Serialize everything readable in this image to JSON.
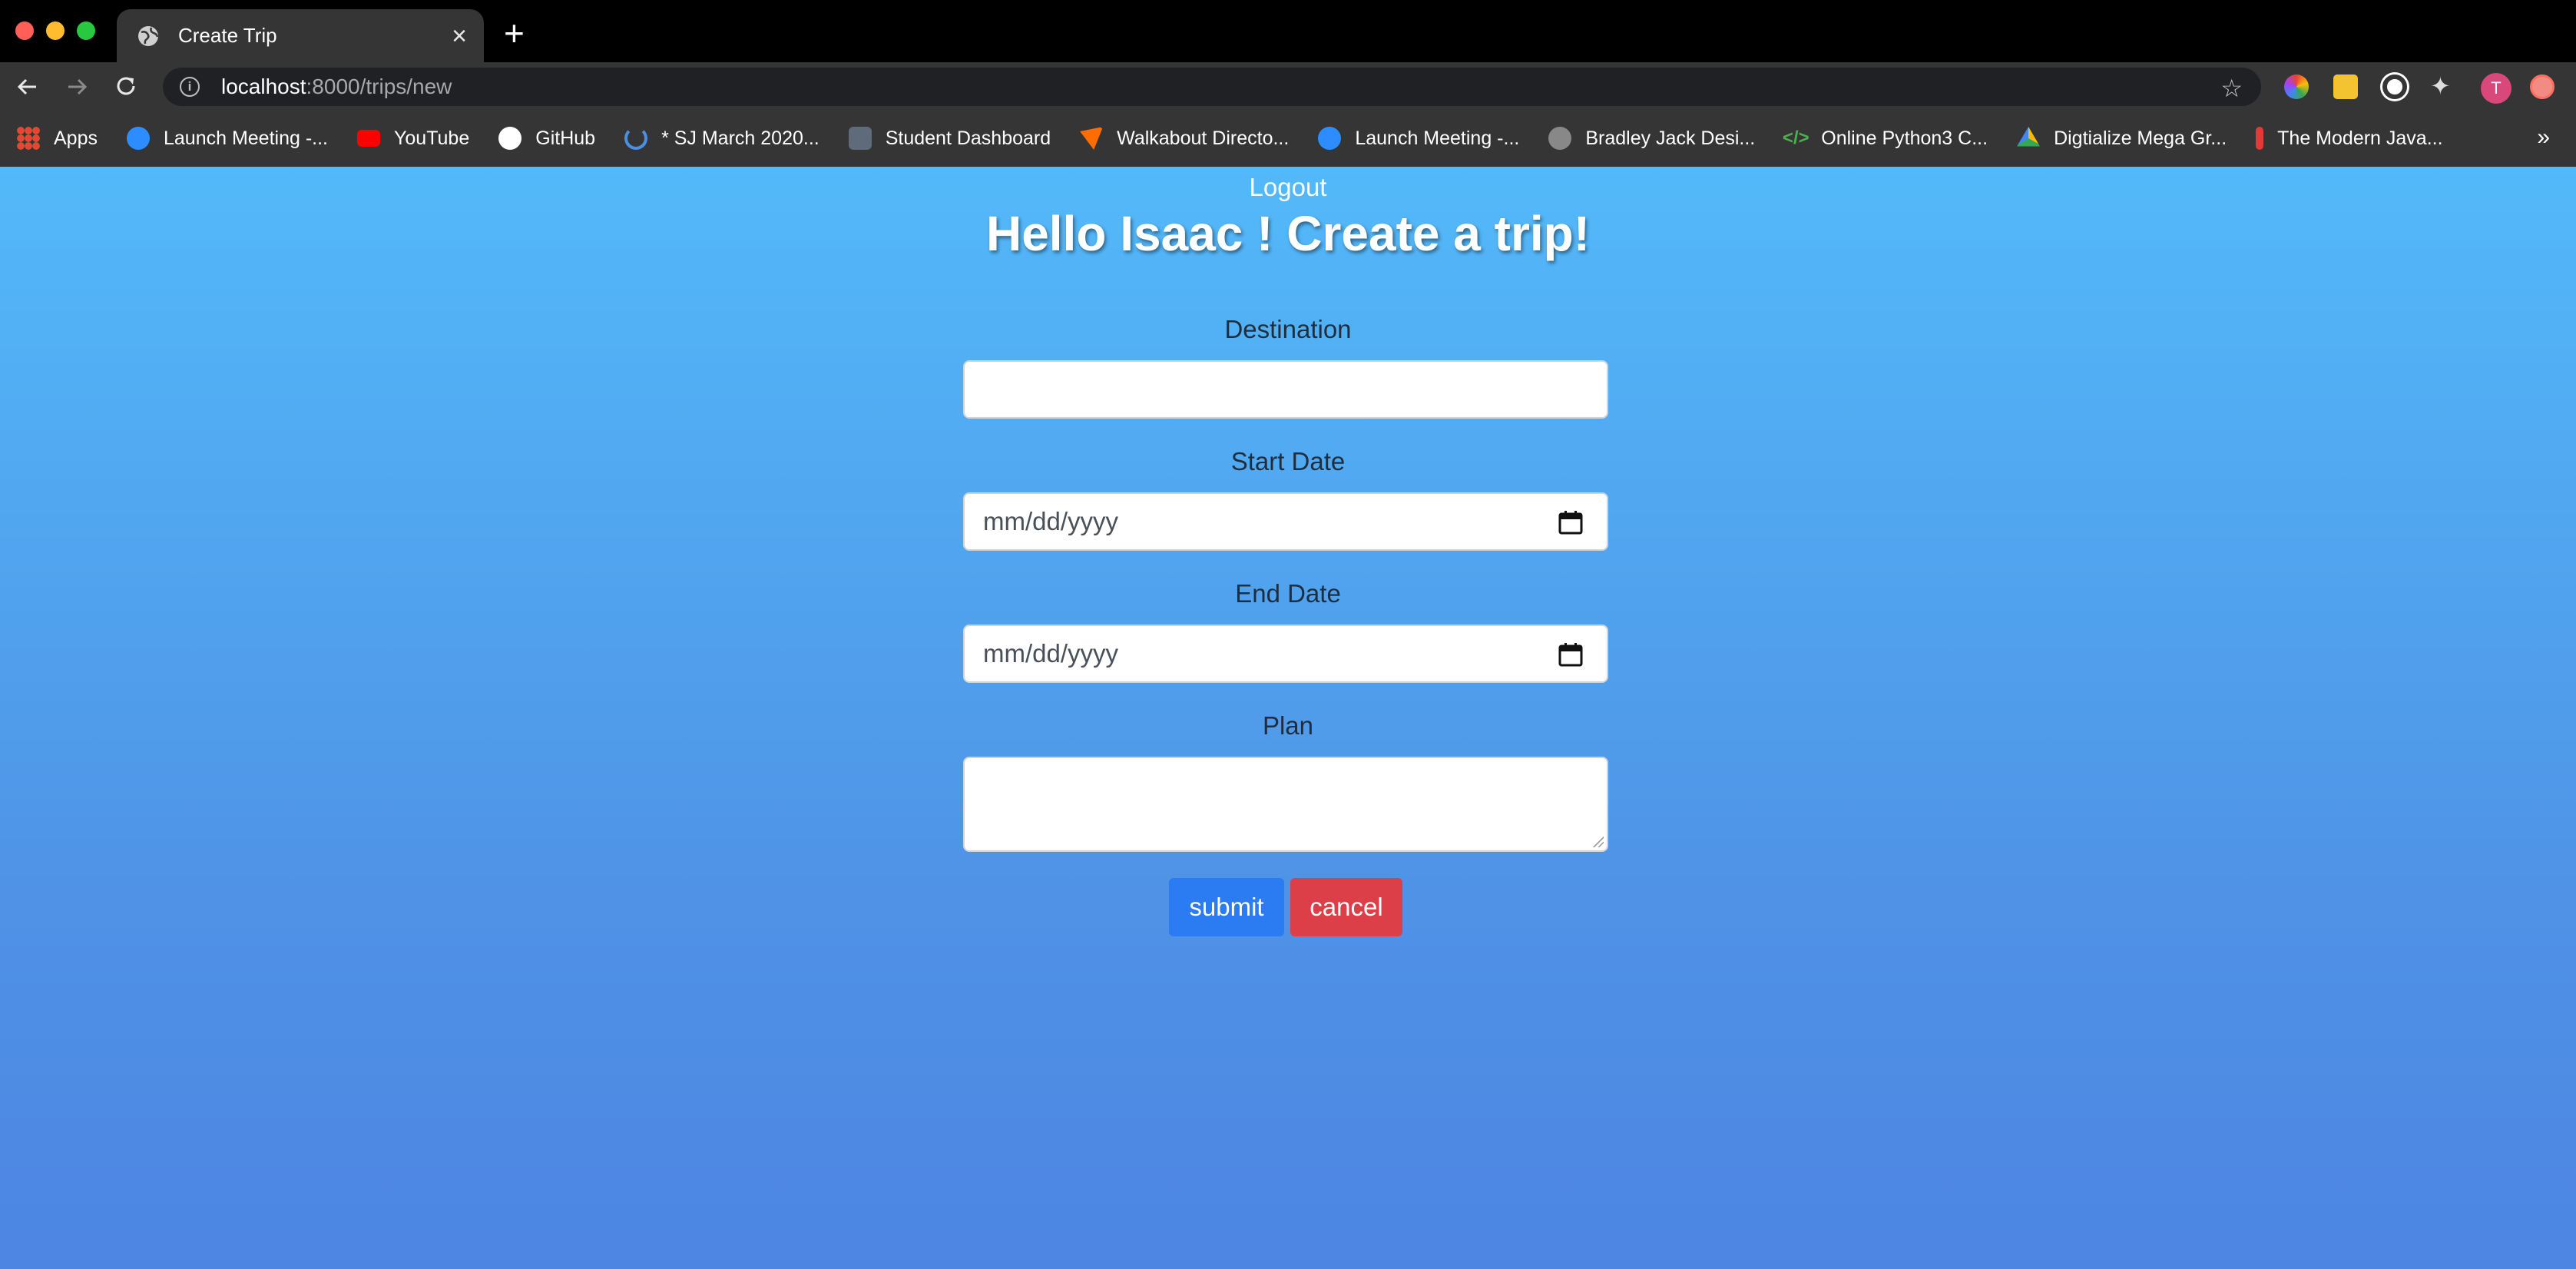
{
  "browser": {
    "tab_title": "Create Trip",
    "url_host": "localhost",
    "url_path": ":8000/trips/new",
    "profile_initial": "T",
    "bookmarks": [
      {
        "label": "Apps",
        "icon": "apps-grid-icon",
        "color": "#ea4335"
      },
      {
        "label": "Launch Meeting -...",
        "icon": "zoom-icon",
        "color": "#2d8cff"
      },
      {
        "label": "YouTube",
        "icon": "youtube-icon",
        "color": "#ff0000"
      },
      {
        "label": "GitHub",
        "icon": "github-icon",
        "color": "#ffffff"
      },
      {
        "label": "* SJ March 2020...",
        "icon": "spinner-icon",
        "color": "#4a90e2"
      },
      {
        "label": "Student Dashboard",
        "icon": "torii-icon",
        "color": "#5f6b7a"
      },
      {
        "label": "Walkabout Directo...",
        "icon": "bird-icon",
        "color": "#ff6d00"
      },
      {
        "label": "Launch Meeting -...",
        "icon": "zoom-icon",
        "color": "#2d8cff"
      },
      {
        "label": "Bradley Jack Desi...",
        "icon": "sparkle-icon",
        "color": "#bbbbbb"
      },
      {
        "label": "Online Python3 C...",
        "icon": "code-icon",
        "color": "#4caf50"
      },
      {
        "label": "Digtialize Mega Gr...",
        "icon": "drive-icon",
        "color": "#fbbc05"
      },
      {
        "label": "The Modern Java...",
        "icon": "js-figure-icon",
        "color": "#e53935"
      }
    ],
    "more_bookmarks": "»"
  },
  "page": {
    "logout": "Logout",
    "heading": "Hello Isaac ! Create a trip!",
    "fields": {
      "destination_label": "Destination",
      "start_label": "Start Date",
      "start_placeholder": "mm/dd/yyyy",
      "end_label": "End Date",
      "end_placeholder": "mm/dd/yyyy",
      "plan_label": "Plan"
    },
    "submit": "submit",
    "cancel": "cancel"
  },
  "colors": {
    "gradient_top": "#53b9f9",
    "gradient_bottom": "#4d85e3",
    "submit_bg": "#2b7bf2",
    "cancel_bg": "#dc3f48"
  }
}
